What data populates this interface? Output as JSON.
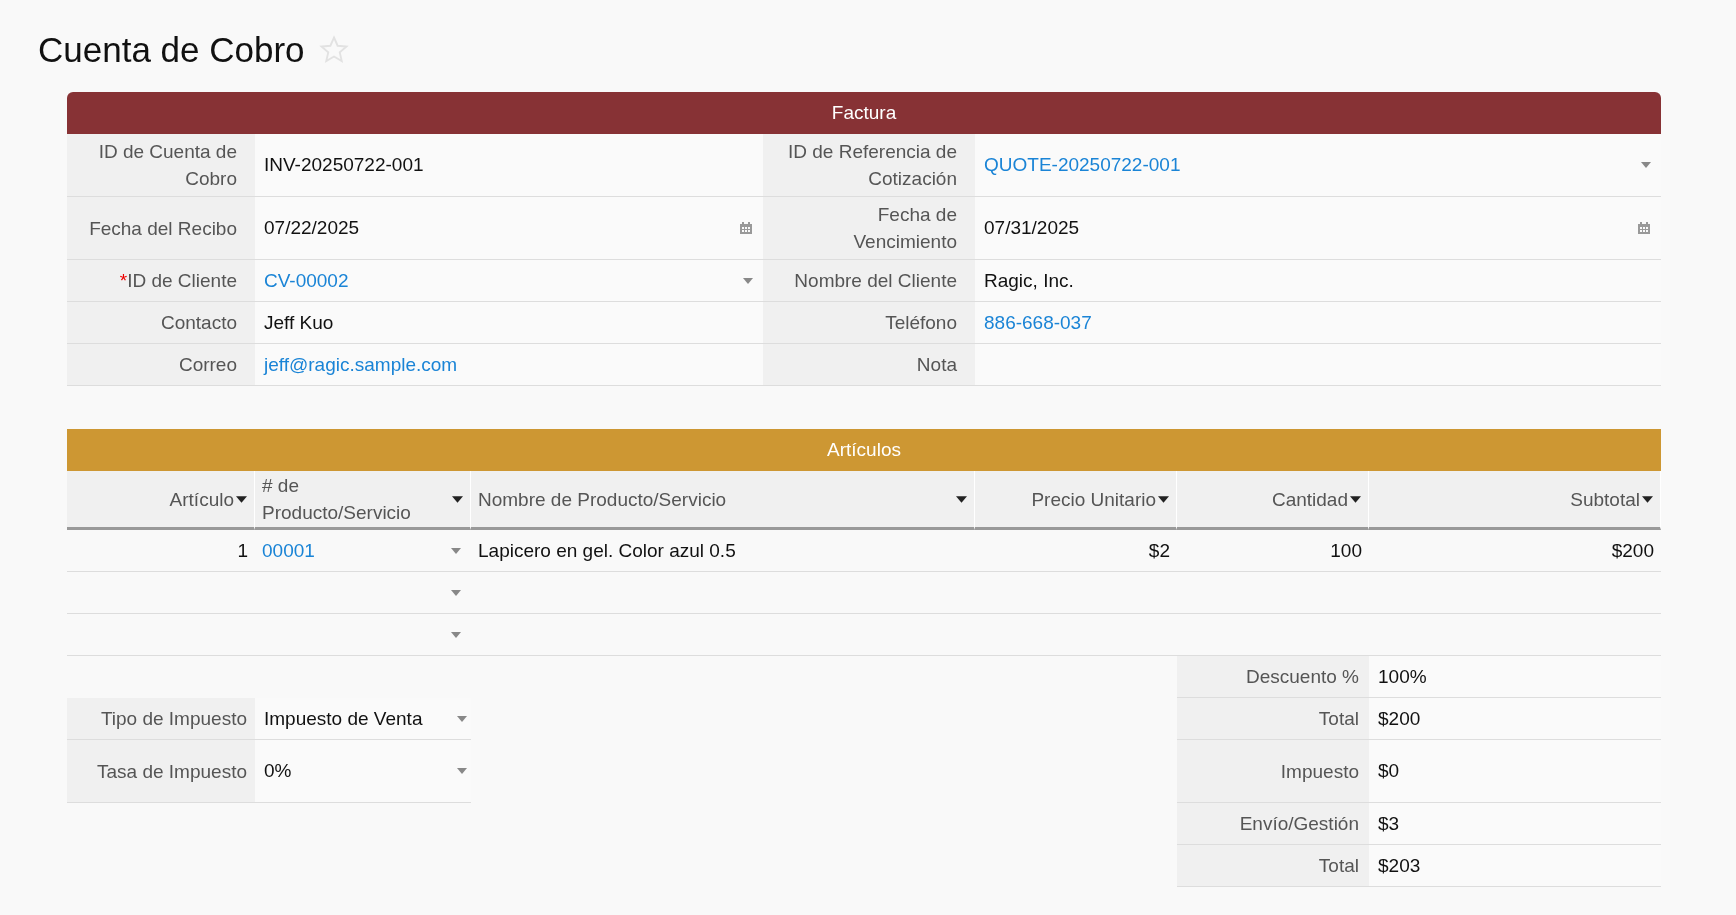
{
  "page": {
    "title": "Cuenta de Cobro",
    "starred": false
  },
  "invoice": {
    "title": "Factura",
    "rows": [
      [
        {
          "label": "ID de Cuenta de Cobro",
          "value": "INV-20250722-001",
          "kind": "text"
        },
        {
          "label": "ID de Referencia de Cotización",
          "value": "QUOTE-20250722-001",
          "kind": "select"
        }
      ],
      [
        {
          "label": "Fecha del Recibo",
          "value": "07/22/2025",
          "kind": "date"
        },
        {
          "label": "Fecha de Vencimiento",
          "value": "07/31/2025",
          "kind": "date"
        }
      ],
      [
        {
          "marker": "*",
          "label": "ID de Cliente",
          "value": "CV-00002",
          "kind": "select"
        },
        {
          "label": "Nombre del Cliente",
          "value": "Ragic, Inc.",
          "kind": "text"
        }
      ],
      [
        {
          "label": "Contacto",
          "value": "Jeff Kuo",
          "kind": "text"
        },
        {
          "label": "Teléfono",
          "value": "886-668-037",
          "kind": "link"
        }
      ],
      [
        {
          "label": "Correo",
          "value": "jeff@ragic.sample.com",
          "kind": "link"
        },
        {
          "label": "Nota",
          "kind": "text"
        }
      ]
    ]
  },
  "items": {
    "title": "Artículos",
    "columns": [
      {
        "label": "Artículo",
        "kind": "number"
      },
      {
        "label": "# de Producto/Servicio",
        "kind": "select"
      },
      {
        "label": "Nombre de Producto/Servicio",
        "kind": "text"
      },
      {
        "label": "Precio Unitario",
        "kind": "number"
      },
      {
        "label": "Cantidad",
        "kind": "number"
      },
      {
        "label": "Subtotal",
        "kind": "number"
      }
    ],
    "rows": [
      {
        "kind": "item",
        "cells": [
          "1",
          "00001",
          "Lapicero en gel. Color azul 0.5",
          "$2",
          "100",
          "$200"
        ]
      },
      {
        "kind": "blank"
      },
      {
        "kind": "blank"
      }
    ]
  },
  "tax": [
    {
      "label": "Tipo de Impuesto",
      "value": "Impuesto de Venta",
      "kind": "select"
    },
    {
      "label": "Tasa de Impuesto",
      "value": "0%",
      "kind": "select"
    }
  ],
  "totals": [
    {
      "label": "Descuento %",
      "value": "100%"
    },
    {
      "label": "Total",
      "value": "$200"
    },
    {
      "label": "Impuesto",
      "value": "$0"
    },
    {
      "label": "Envío/Gestión",
      "value": "$3"
    },
    {
      "label": "Total",
      "value": "$203"
    }
  ]
}
